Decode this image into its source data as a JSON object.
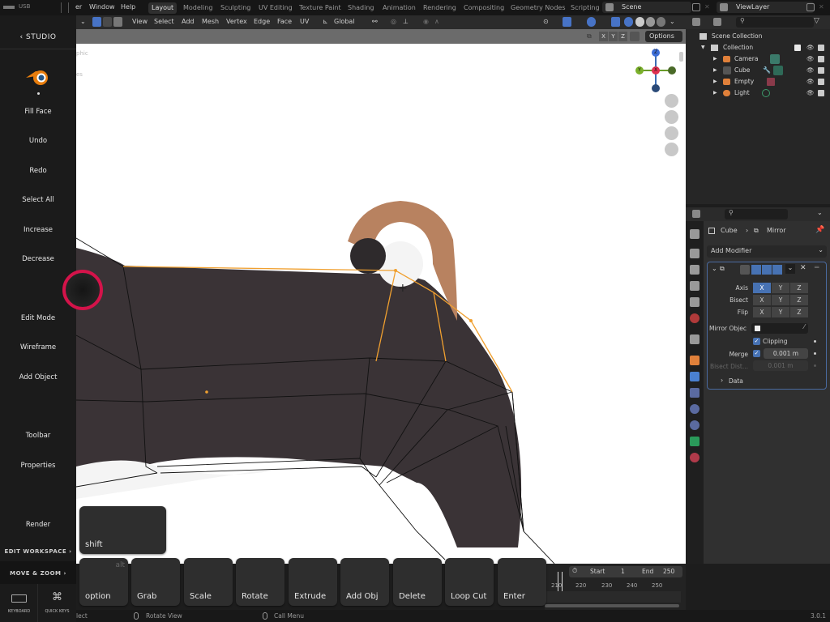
{
  "topbar": {
    "usb_label": "USB",
    "menus": [
      "er",
      "Window",
      "Help"
    ],
    "workspaces": [
      "Layout",
      "Modeling",
      "Sculpting",
      "UV Editing",
      "Texture Paint",
      "Shading",
      "Animation",
      "Rendering",
      "Compositing",
      "Geometry Nodes",
      "Scripting"
    ],
    "active_workspace": "Layout",
    "scene_name": "Scene",
    "view_layer": "ViewLayer"
  },
  "header": {
    "menus": [
      "View",
      "Select",
      "Add",
      "Mesh",
      "Vertex",
      "Edge",
      "Face",
      "UV"
    ],
    "transform_orientation": "Global",
    "axis_buttons": [
      "X",
      "Y",
      "Z"
    ],
    "options_label": "Options"
  },
  "viewport": {
    "overlay_text_1": "phic",
    "overlay_text_2": "es",
    "gizmo_axes": {
      "z": "Z",
      "x": "X",
      "y": "Y"
    },
    "colors": {
      "selected_edge": "#f0a030",
      "edge": "#111111",
      "touch_ring": "#d4134a"
    }
  },
  "studio": {
    "back_label": "‹ STUDIO",
    "items": [
      "Fill Face",
      "Undo",
      "Redo",
      "Select All",
      "Increase",
      "Decrease",
      "Edit Mode",
      "Wireframe",
      "Add Object",
      "Toolbar",
      "Properties",
      "Render"
    ],
    "edit_workspace": "EDIT WORKSPACE ›",
    "move_zoom": "MOVE & ZOOM ›",
    "keyboard": "KEYBOARD",
    "quick_keys": "QUICK KEYS"
  },
  "keys": {
    "shift": "shift",
    "alt": "alt",
    "row": [
      "option",
      "Grab",
      "Scale",
      "Rotate",
      "Extrude",
      "Add Obj",
      "Delete",
      "Loop Cut",
      "Enter"
    ]
  },
  "outliner": {
    "root": "Scene Collection",
    "collection": "Collection",
    "objects": [
      {
        "name": "Camera",
        "color": "#e0803a"
      },
      {
        "name": "Cube",
        "color": "#e0803a"
      },
      {
        "name": "Empty",
        "color": "#e0803a"
      },
      {
        "name": "Light",
        "color": "#e0803a"
      }
    ]
  },
  "properties": {
    "breadcrumb_object": "Cube",
    "breadcrumb_modifier": "Mirror",
    "add_modifier": "Add Modifier",
    "axis_label": "Axis",
    "bisect_label": "Bisect",
    "flip_label": "Flip",
    "axes": [
      "X",
      "Y",
      "Z"
    ],
    "mirror_object_label": "Mirror Objec",
    "clipping_label": "Clipping",
    "clipping_checked": true,
    "merge_label": "Merge",
    "merge_checked": true,
    "merge_value": "0.001 m",
    "bisect_distance_label": "Bisect Dist...",
    "bisect_distance_value": "0.001 m",
    "data_label": "Data"
  },
  "timeline": {
    "start_label": "Start",
    "start_value": "1",
    "end_label": "End",
    "end_value": "250",
    "ticks": [
      "210",
      "220",
      "230",
      "240",
      "250"
    ]
  },
  "statusbar": {
    "select": "lect",
    "rotate_view": "Rotate View",
    "call_menu": "Call Menu",
    "version": "3.0.1"
  }
}
